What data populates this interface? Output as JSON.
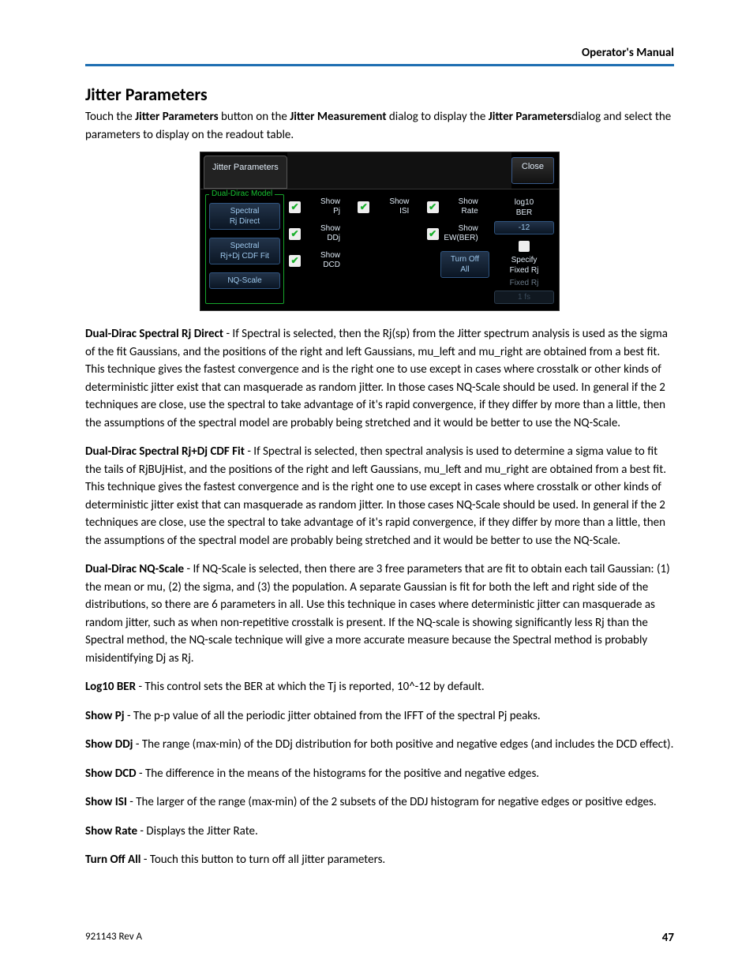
{
  "header": {
    "right": "Operator's Manual"
  },
  "title": "Jitter Parameters",
  "intro": {
    "pre": "Touch the ",
    "b1": "Jitter Parameters",
    "mid1": " button on the ",
    "b2": "Jitter Measurement",
    "mid2": " dialog to display the ",
    "b3": "Jitter Parameters",
    "end": "dialog and select the parameters to display on the readout table."
  },
  "dialog": {
    "tab": "Jitter Parameters",
    "close": "Close",
    "left_legend": "Dual-Dirac Model",
    "model_btns": [
      "Spectral\nRj Direct",
      "Spectral\nRj+Dj CDF Fit",
      "NQ-Scale"
    ],
    "checks": {
      "c0": "Show\nPj",
      "c1": "Show\nDDj",
      "c2": "Show\nDCD",
      "c3": "Show\nISI",
      "c4": "Show\nRate",
      "c5": "Show\nEW(BER)"
    },
    "turn_off": "Turn Off\nAll",
    "right": {
      "log_lbl": "log10\nBER",
      "log_val": "-12",
      "specify_lbl": "Specify\nFixed Rj",
      "fixed_lbl": "Fixed Rj",
      "fixed_val": "1 fs"
    }
  },
  "paras": {
    "p1": {
      "b": "Dual-Dirac Spectral Rj Direct",
      "t": " - If Spectral is selected, then the Rj(sp) from the Jitter spectrum analysis is used as the sigma of the fit Gaussians, and the positions of the right and left Gaussians, mu_left and mu_right are obtained from a best fit. This technique gives the fastest convergence and is the right one to use except in cases where crosstalk or other kinds of deterministic jitter exist that can masquerade as random jitter. In those cases NQ-Scale should be used. In general if the 2 techniques are close, use the spectral to take advantage of it's rapid convergence, if they differ by more than a little, then the assumptions of the spectral model are probably being stretched and it would be better to use the NQ-Scale."
    },
    "p2": {
      "b": "Dual-Dirac Spectral Rj+Dj CDF Fit",
      "t": " - If Spectral is selected, then spectral analysis is used to determine a sigma value to fit the tails of RjBUjHist, and the positions of the right and left Gaussians, mu_left and mu_right are obtained from a best fit. This technique gives the fastest convergence and is the right one to use except in cases where crosstalk or other kinds of deterministic jitter exist that can masquerade as random jitter. In those cases NQ-Scale should be used. In general if the 2 techniques are close, use the spectral to take advantage of it's rapid convergence, if they differ by more than a little, then the assumptions of the spectral model are probably being stretched and it would be better to use the NQ-Scale."
    },
    "p3": {
      "b": "Dual-Dirac NQ-Scale",
      "t": " - If NQ-Scale is selected, then there are 3 free parameters that are fit to obtain each tail Gaussian: (1) the mean or mu, (2) the sigma, and (3) the population. A separate Gaussian is fit for both the left and right side of the distributions, so there are 6 parameters in all. Use this technique in cases where deterministic jitter can masquerade as random jitter, such as when non-repetitive crosstalk is present. If the NQ-scale is showing significantly less Rj than the Spectral method, the NQ-scale technique will give a more accurate measure because the Spectral method is probably misidentifying Dj as Rj."
    },
    "p4": {
      "b": "Log10 BER",
      "t": " - This control sets the BER at which the Tj is reported, 10^-12 by default."
    },
    "p5": {
      "b": "Show Pj",
      "t": " - The p-p value of all the periodic jitter obtained from the IFFT of the spectral Pj peaks."
    },
    "p6": {
      "b": "Show DDj",
      "t": " - The range (max-min) of the DDj distribution for both positive and negative edges (and includes the DCD effect)."
    },
    "p7": {
      "b": "Show DCD",
      "t": " - The difference in the means of the histograms for the positive and negative edges."
    },
    "p8": {
      "b": "Show ISI",
      "t": " - The larger of the range (max-min) of the 2 subsets of the DDJ histogram for negative edges or positive edges."
    },
    "p9": {
      "b": "Show Rate",
      "t": " - Displays the Jitter Rate."
    },
    "p10": {
      "b": "Turn Off All",
      "t": " - Touch this button to turn off all jitter parameters."
    }
  },
  "footer": {
    "doc": "921143 Rev A",
    "page": "47"
  }
}
